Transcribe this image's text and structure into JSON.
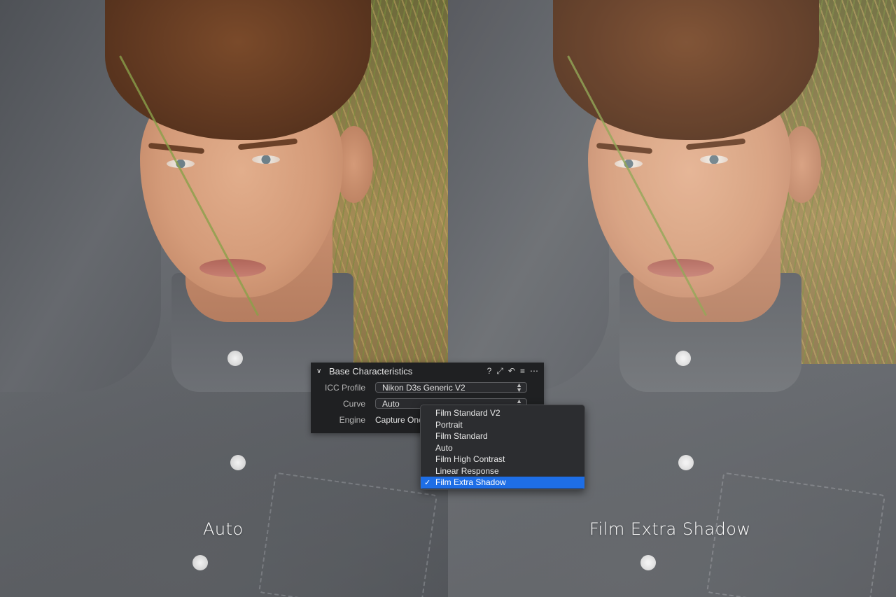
{
  "comparison": {
    "left_caption": "Auto",
    "right_caption": "Film Extra Shadow"
  },
  "panel": {
    "title": "Base Characteristics",
    "header_icons": [
      "help-icon",
      "copy-apply-icon",
      "reset-icon",
      "list-icon",
      "more-icon"
    ],
    "header_icon_glyphs": [
      "?",
      "⤢",
      "↶",
      "≡",
      "⋯"
    ],
    "icc_profile_label": "ICC Profile",
    "icc_profile_value": "Nikon D3s Generic V2",
    "curve_label": "Curve",
    "curve_value": "Auto",
    "engine_label": "Engine",
    "engine_value": "Capture One"
  },
  "curve_menu": {
    "items": [
      {
        "label": "Film Standard V2",
        "selected": false
      },
      {
        "label": "Portrait",
        "selected": false
      },
      {
        "label": "Film Standard",
        "selected": false
      },
      {
        "label": "Auto",
        "selected": false
      },
      {
        "label": "Film High Contrast",
        "selected": false
      },
      {
        "label": "Linear Response",
        "selected": false
      },
      {
        "label": "Film Extra Shadow",
        "selected": true
      }
    ],
    "check_glyph": "✓"
  },
  "colors": {
    "selection": "#1e6ee6",
    "panel_bg": "#1f2022",
    "menu_bg": "#2c2d30"
  }
}
